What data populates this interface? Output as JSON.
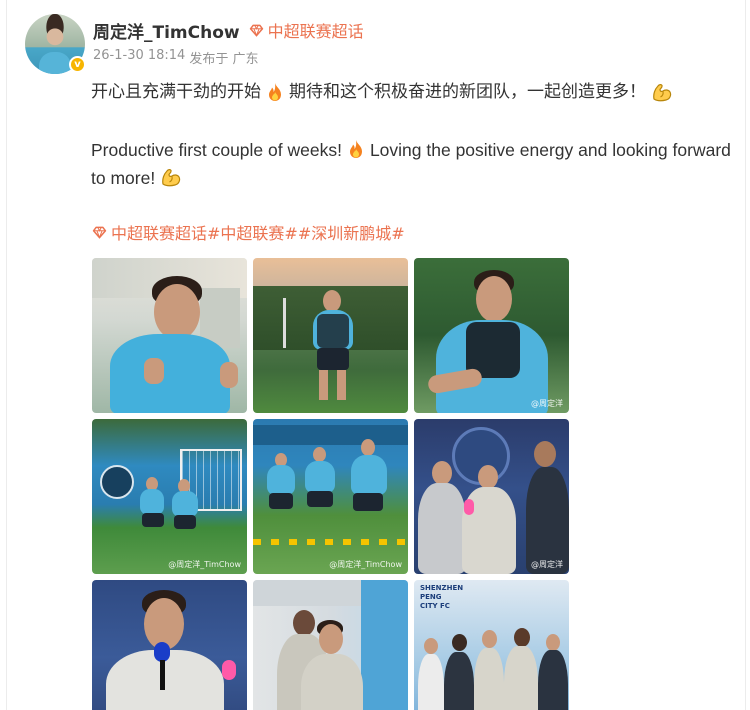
{
  "post": {
    "author": "周定洋_TimChow",
    "topic": "中超联赛超话",
    "timestamp": "26-1-30 18:14",
    "posted_from": "发布于 广东",
    "verified_badge": "v",
    "text_zh_1": "开心且充满干劲的开始",
    "text_zh_2": "期待和这个积极奋进的新团队，一起创造更多！",
    "text_en_1": "Productive first couple of weeks!",
    "text_en_2": "Loving the positive energy and looking forward to more!",
    "tags": "中超联赛超话#中超联赛##深圳新鹏城#",
    "emoji": {
      "fire": "fire-icon",
      "muscle": "flexed-biceps-icon"
    }
  },
  "colors": {
    "accent": "#eb7350",
    "text": "#333333",
    "meta": "#939393",
    "verified": "#f7b500",
    "team_blue": "#4fb3dc"
  },
  "photos": [
    {
      "name": "photo-smiling-thumbs-up"
    },
    {
      "name": "photo-training-standing"
    },
    {
      "name": "photo-training-vest",
      "watermark": "@周定洋"
    },
    {
      "name": "photo-training-drill-1",
      "watermark": "@周定洋_TimChow"
    },
    {
      "name": "photo-training-drill-2",
      "watermark": "@周定洋_TimChow"
    },
    {
      "name": "photo-interview-group",
      "watermark": "@周定洋"
    },
    {
      "name": "photo-interview-mic"
    },
    {
      "name": "photo-event-players"
    },
    {
      "name": "photo-fans-group",
      "sign_text": "SHENZHEN PENG CITY FC"
    }
  ]
}
